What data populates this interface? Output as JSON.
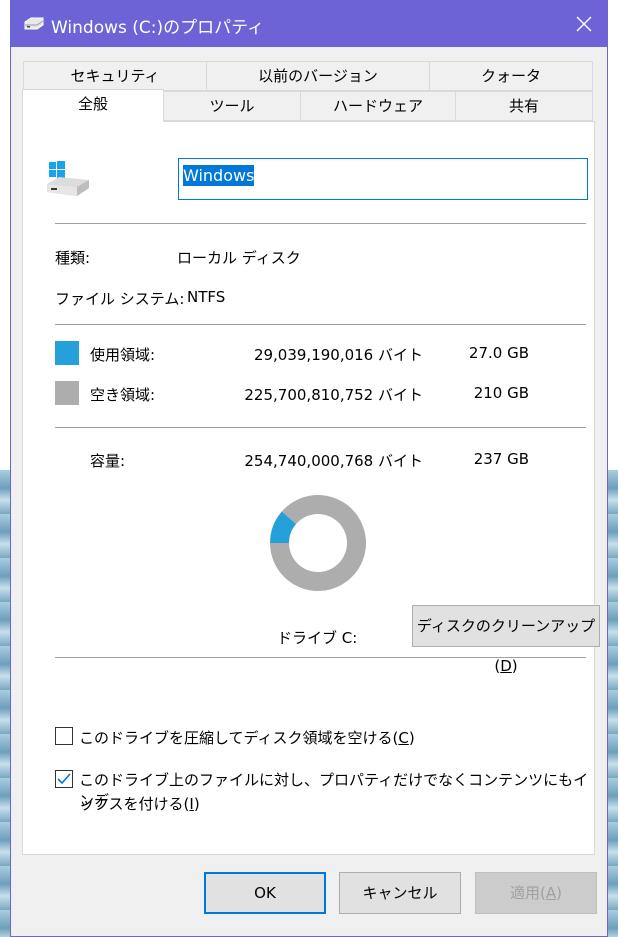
{
  "window": {
    "title": "Windows (C:)のプロパティ",
    "accent_color": "#6b63d6",
    "title_icon": "drive-icon",
    "close_icon": "close-icon"
  },
  "tabs": {
    "row_back": [
      {
        "label": "セキュリティ"
      },
      {
        "label": "以前のバージョン"
      },
      {
        "label": "クォータ"
      }
    ],
    "row_front": [
      {
        "label": "全般",
        "active": true
      },
      {
        "label": "ツール"
      },
      {
        "label": "ハードウェア"
      },
      {
        "label": "共有"
      }
    ]
  },
  "general": {
    "drive_name": "Windows",
    "type_label": "種類:",
    "type_value": "ローカル ディスク",
    "fs_label": "ファイル システム:",
    "fs_value": "NTFS",
    "used": {
      "label": "使用領域:",
      "bytes": "29,039,190,016 バイト",
      "size": "27.0 GB",
      "color": "#26a0da"
    },
    "free": {
      "label": "空き領域:",
      "bytes": "225,700,810,752 バイト",
      "size": "210 GB",
      "color": "#adadad"
    },
    "capacity": {
      "label": "容量:",
      "bytes": "254,740,000,768 バイト",
      "size": "237 GB"
    },
    "used_fraction": 0.114,
    "drive_label": "ドライブ C:",
    "cleanup_button": {
      "text": "ディスクのクリーンアップ(",
      "key": "D",
      "end": ")"
    }
  },
  "options": {
    "compress": {
      "text": "このドライブを圧縮してディスク領域を空ける(",
      "key": "C",
      "end": ")",
      "checked": false
    },
    "index": {
      "line1": "このドライブ上のファイルに対し、プロパティだけでなくコンテンツにもインデ",
      "line2": "ックスを付ける(",
      "key": "I",
      "end": ")",
      "checked": true
    }
  },
  "buttons": {
    "ok": "OK",
    "cancel": "キャンセル",
    "apply": {
      "text": "適用(",
      "key": "A",
      "end": ")"
    }
  }
}
